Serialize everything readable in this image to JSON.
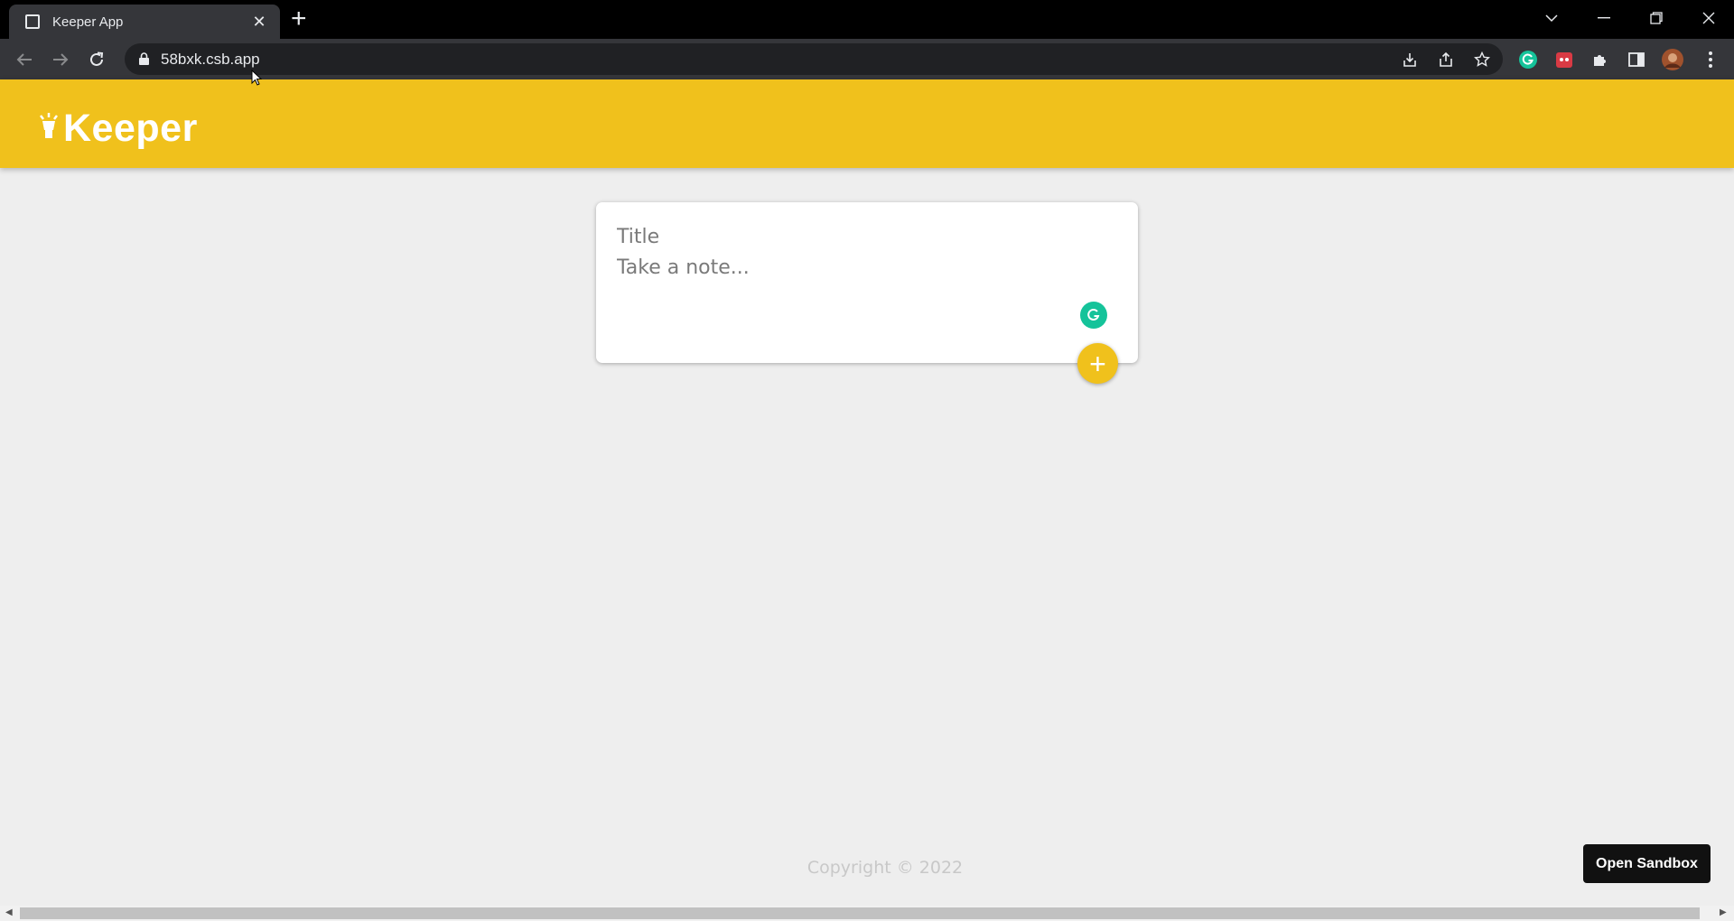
{
  "browser": {
    "tab_title": "Keeper App",
    "url": "58bxk.csb.app"
  },
  "app": {
    "brand": "Keeper",
    "brand_color": "#f0c11c",
    "form": {
      "title_placeholder": "Title",
      "content_placeholder": "Take a note...",
      "add_label": "+"
    },
    "footer": "Copyright © 2022",
    "open_sandbox": "Open Sandbox"
  }
}
